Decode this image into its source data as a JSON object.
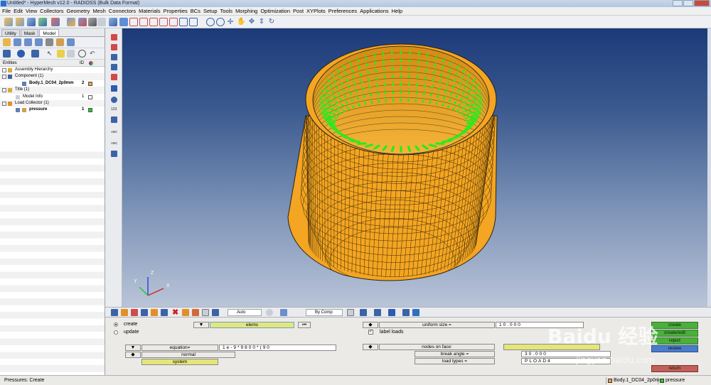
{
  "window": {
    "title": "Untitled* - HyperMesh v12.0 - RADIOSS (Bulk Data Format)"
  },
  "menu": [
    "File",
    "Edit",
    "View",
    "Collectors",
    "Geometry",
    "Mesh",
    "Connectors",
    "Materials",
    "Properties",
    "BCs",
    "Setup",
    "Tools",
    "Morphing",
    "Optimization",
    "Post",
    "XYPlots",
    "Preferences",
    "Applications",
    "Help"
  ],
  "left_panel": {
    "tabs": [
      "Utility",
      "Mask",
      "Model"
    ],
    "active_tab": "Model",
    "entities_header": {
      "entities": "Entities",
      "id": "ID"
    },
    "tree": [
      {
        "label": "Assembly Hierarchy",
        "id": "",
        "bold": false
      },
      {
        "label": "Component (1)",
        "id": "",
        "bold": false
      },
      {
        "label": "Body.1_DC04_2p0mm",
        "id": "2",
        "bold": true,
        "color": "#e8a33c"
      },
      {
        "label": "Title (1)",
        "id": "",
        "bold": false
      },
      {
        "label": "Model Info",
        "id": "1",
        "bold": false,
        "color": "#ffffff"
      },
      {
        "label": "Load Collector (1)",
        "id": "",
        "bold": false
      },
      {
        "label": "pressure",
        "id": "1",
        "bold": true,
        "color": "#22cc22"
      }
    ]
  },
  "vtoolbar_labels": {
    "num": "123",
    "abc1": "ABC",
    "abc2": "ABC"
  },
  "triad": {
    "x": "X",
    "y": "Y",
    "z": "Z"
  },
  "iconbar": {
    "vis_mode": "Auto",
    "color_mode": "By Comp"
  },
  "panel": {
    "create": "create",
    "update": "update",
    "selected_mode": "create",
    "elems": "elems",
    "equation": "equation=",
    "equation_value": "1e-9*9800*(90",
    "normal": "normal",
    "system": "system",
    "uniform_size": "uniform size =",
    "uniform_size_value": "10.000",
    "label_loads": "label loads",
    "label_loads_checked": true,
    "nodes_on_face": "nodes on face:",
    "break_angle": "break angle =",
    "break_angle_value": "30.000",
    "load_types": "load types =",
    "load_types_value": "PLOAD4",
    "buttons": {
      "create": "create",
      "create_edit": "create/edit",
      "reject": "reject",
      "review": "review",
      "return": "return"
    }
  },
  "status": {
    "left": "Pressures: Create",
    "comp": "Body.1_DC04_2p0mm",
    "load": "pressure"
  },
  "colors": {
    "mesh": "#f4a521",
    "arrows": "#2bea1f",
    "green_btn": "#4cae3e",
    "return_btn": "#c0605a"
  },
  "watermark": {
    "text": "Baidu 经验",
    "url": "jingyan.baidu.com"
  }
}
